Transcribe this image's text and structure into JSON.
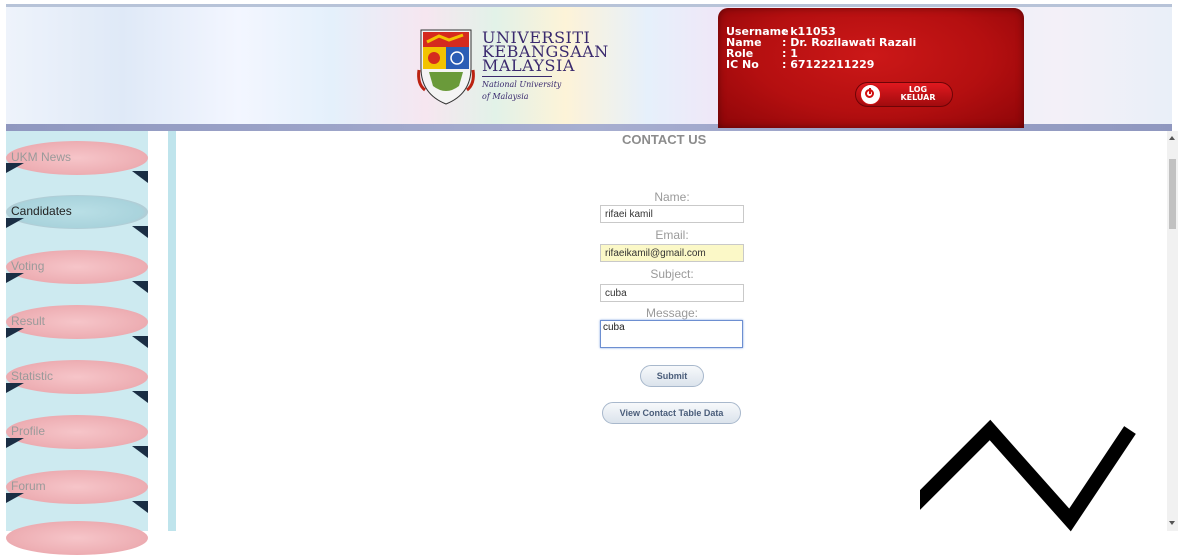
{
  "header": {
    "logo": {
      "line1": "UNIVERSITI",
      "line2": "KEBANGSAAN",
      "line3": "MALAYSIA",
      "tagline1": "National University",
      "tagline2": "of Malaysia"
    },
    "user": {
      "username_label": "Username",
      "username_value": ": k11053",
      "name_label": "Name",
      "name_value": ": Dr. Rozilawati Razali",
      "role_label": "Role",
      "role_value": ": 1",
      "ic_label": "IC No",
      "ic_value": ": 67122211229"
    },
    "logout": {
      "line1": "LOG",
      "line2": "KELUAR"
    }
  },
  "sidebar": {
    "items": [
      {
        "label": "UKM News"
      },
      {
        "label": "Candidates"
      },
      {
        "label": "Voting"
      },
      {
        "label": "Result"
      },
      {
        "label": "Statistic"
      },
      {
        "label": "Profile"
      },
      {
        "label": "Forum"
      }
    ]
  },
  "main": {
    "title": "CONTACT US",
    "form": {
      "name_label": "Name:",
      "name_value": "rifaei kamil",
      "email_label": "Email:",
      "email_value": "rifaeikamil@gmail.com",
      "subject_label": "Subject:",
      "subject_value": "cuba",
      "message_label": "Message:",
      "message_value": "cuba"
    },
    "submit_label": "Submit",
    "view_table_label": "View Contact Table Data"
  },
  "colors": {
    "user_panel": "#b40f10",
    "nav_pill": "#eeb0b5",
    "sidebar_bg": "#cdeaf0",
    "title_text": "#8c8c8c"
  }
}
